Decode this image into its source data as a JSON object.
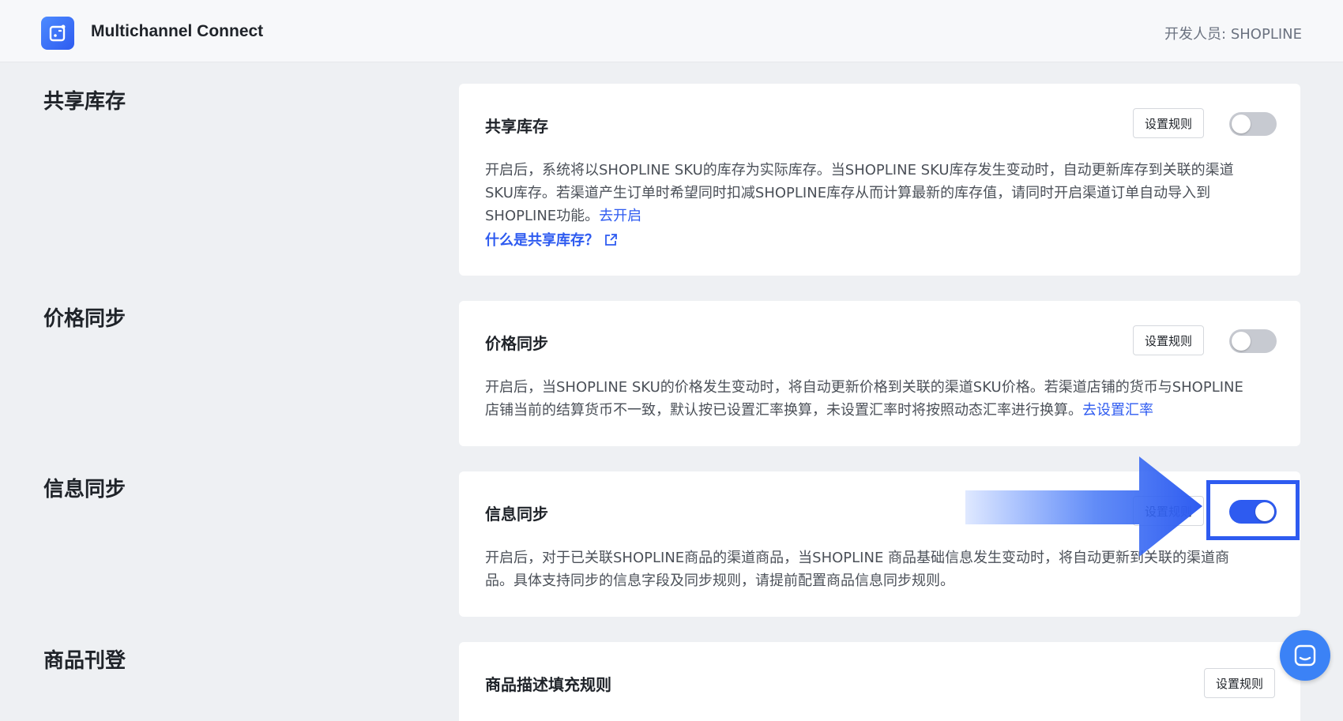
{
  "header": {
    "app_title": "Multichannel Connect",
    "developer": "开发人员: SHOPLINE"
  },
  "sections": [
    {
      "title": "共享库存",
      "card_title": "共享库存",
      "rule_button": "设置规则",
      "toggle_on": false,
      "desc_line1": "开启后，系统将以SHOPLINE SKU的库存为实际库存。当SHOPLINE SKU库存发生变动时，自动更新库存到关联的渠道",
      "desc_line2": "SKU库存。若渠道产生订单时希望同时扣减SHOPLINE库存从而计算最新的库存值，请同时开启渠道订单自动导入到",
      "desc_line3": "SHOPLINE功能。",
      "desc_link": "去开启",
      "help_link": "什么是共享库存？"
    },
    {
      "title": "价格同步",
      "card_title": "价格同步",
      "rule_button": "设置规则",
      "toggle_on": false,
      "desc_line1": "开启后，当SHOPLINE SKU的价格发生变动时，将自动更新价格到关联的渠道SKU价格。若渠道店铺的货币与SHOPLINE",
      "desc_line2": "店铺当前的结算货币不一致，默认按已设置汇率换算，未设置汇率时将按照动态汇率进行换算。",
      "desc_link": "去设置汇率"
    },
    {
      "title": "信息同步",
      "card_title": "信息同步",
      "rule_button": "设置规则",
      "toggle_on": true,
      "desc_line1": "开启后，对于已关联SHOPLINE商品的渠道商品，当SHOPLINE 商品基础信息发生变动时，将自动更新到关联的渠道商",
      "desc_line2": "品。具体支持同步的信息字段及同步规则，请提前配置商品信息同步规则。"
    },
    {
      "title": "商品刊登",
      "card_title": "商品描述填充规则",
      "rule_button": "设置规则"
    }
  ],
  "colors": {
    "accent": "#2e5bf0",
    "background": "#eef0f3"
  }
}
